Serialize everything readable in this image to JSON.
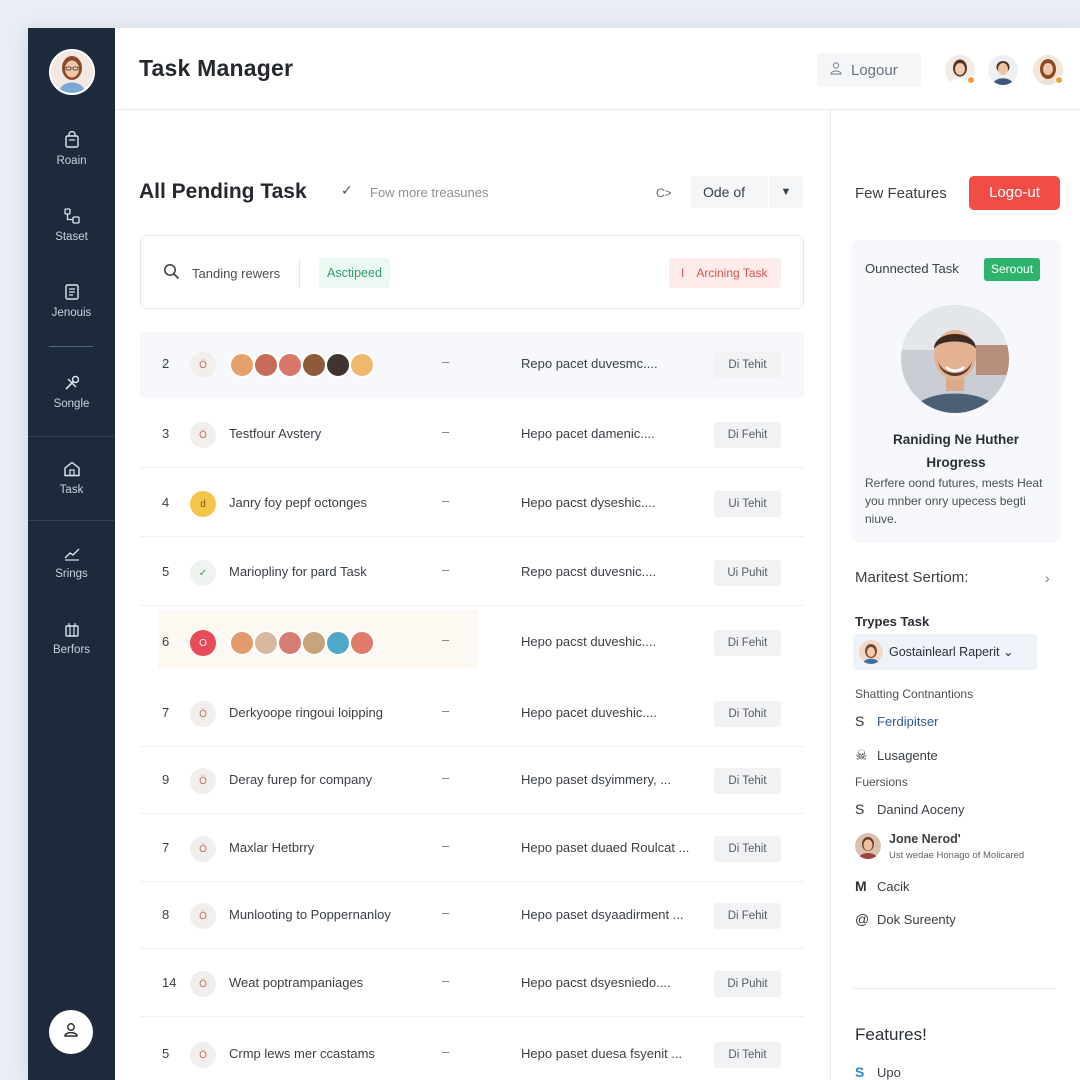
{
  "app": {
    "title": "Task Manager"
  },
  "header": {
    "logout_label": "Logour"
  },
  "sidebar": {
    "items": [
      {
        "label": "Roain",
        "icon": "bag-icon"
      },
      {
        "label": "Staset",
        "icon": "flow-icon"
      },
      {
        "label": "Jenouis",
        "icon": "document-icon"
      },
      {
        "label": "Songle",
        "icon": "tools-icon"
      },
      {
        "label": "Task",
        "icon": "home-icon"
      },
      {
        "label": "Srings",
        "icon": "chart-icon"
      },
      {
        "label": "Berfors",
        "icon": "grid-icon"
      }
    ]
  },
  "main": {
    "title": "All Pending Task",
    "subtitle": "Fow more treasunes",
    "sort_icon": "C>",
    "order_label": "Ode of",
    "filter": {
      "search_label": "Tanding rewers",
      "badge_green": "Asctipeed",
      "badge_red_icon": "I",
      "badge_red": "Arcining Task"
    },
    "rows": [
      {
        "num": "2",
        "status": "Ö",
        "name": "",
        "desc": "Repo pacet duvesmc....",
        "tag": "Di Tehit"
      },
      {
        "num": "3",
        "status": "Ö",
        "name": "Testfour Avstery",
        "desc": "Hepo pacet damenic....",
        "tag": "Di Fehit"
      },
      {
        "num": "4",
        "status": "d",
        "name": "Janry foy pepf octonges",
        "desc": "Hepo pacst dyseshic....",
        "tag": "Ui Tehit"
      },
      {
        "num": "5",
        "status": "✓",
        "name": "Marioplinу for pard Task",
        "desc": "Repo pacst duvesnic....",
        "tag": "Ui Puhit"
      },
      {
        "num": "6",
        "status": "O",
        "name": "",
        "desc": "Hepo pacst duveshic....",
        "tag": "Di Fehit"
      },
      {
        "num": "7",
        "status": "Ö",
        "name": "Derkyoope ringoui loipping",
        "desc": "Hepo pacet duveshic....",
        "tag": "Di Tohit"
      },
      {
        "num": "9",
        "status": "Ö",
        "name": "Deray furep for company",
        "desc": "Hepo paset dsyimmery, ...",
        "tag": "Di Tehit"
      },
      {
        "num": "7",
        "status": "Ö",
        "name": "Maxlar Hetbrry",
        "desc": "Hepo paset duaed Roulcat ...",
        "tag": "Di Tehit"
      },
      {
        "num": "8",
        "status": "Ö",
        "name": "Munlooting to Poppernanloy",
        "desc": "Hepo paset dsyaadirment ...",
        "tag": "Di Fehit"
      },
      {
        "num": "14",
        "status": "Ö",
        "name": "Weat poptrampaniages",
        "desc": "Hepo pacst dsyesniedo....",
        "tag": "Di Puhit"
      },
      {
        "num": "5",
        "status": "Ö",
        "name": "Crmp lews mer ccastams",
        "desc": "Hepo paset duesa fsyenit ...",
        "tag": "Di Tehit"
      }
    ]
  },
  "right": {
    "few_label": "Few Features",
    "logout_button": "Logo-ut",
    "profile": {
      "caption": "Ounnected Task",
      "badge": "Seroout",
      "name_line1": "Raniding Ne Huther",
      "name_line2": "Hrogress",
      "description": "Rerfere oond futures, mests Heat you mnber onry upecess begti niuve."
    },
    "section_title": "Maritest Sertiom:",
    "types_label": "Trypes Task",
    "type_select": "Gostainlearl Raperit ⌄",
    "shatting_label": "Shatting Contnantions",
    "items1": [
      {
        "icon": "S",
        "label": "Ferdipitser"
      },
      {
        "icon": "☠",
        "label": "Lusagente"
      }
    ],
    "fuersions_label": "Fuersions",
    "item_daniel": {
      "icon": "S",
      "label": "Danind Aoceny"
    },
    "person": {
      "name": "Jone Nerod'",
      "sub": "Ust wedae Honago of Molicared"
    },
    "item_cacik": {
      "icon": "M",
      "label": "Cacik"
    },
    "item_dok": {
      "icon": "@",
      "label": "Dok Sureenty"
    },
    "features_title": "Features!",
    "item_upo": {
      "icon": "S",
      "label": "Upo"
    }
  },
  "colors": {
    "sidebar_bg": "#1d2a3b",
    "accent_red": "#ef4d46",
    "accent_green": "#2db36b",
    "status_yellow": "#f5c54a",
    "status_red": "#e64b57"
  }
}
